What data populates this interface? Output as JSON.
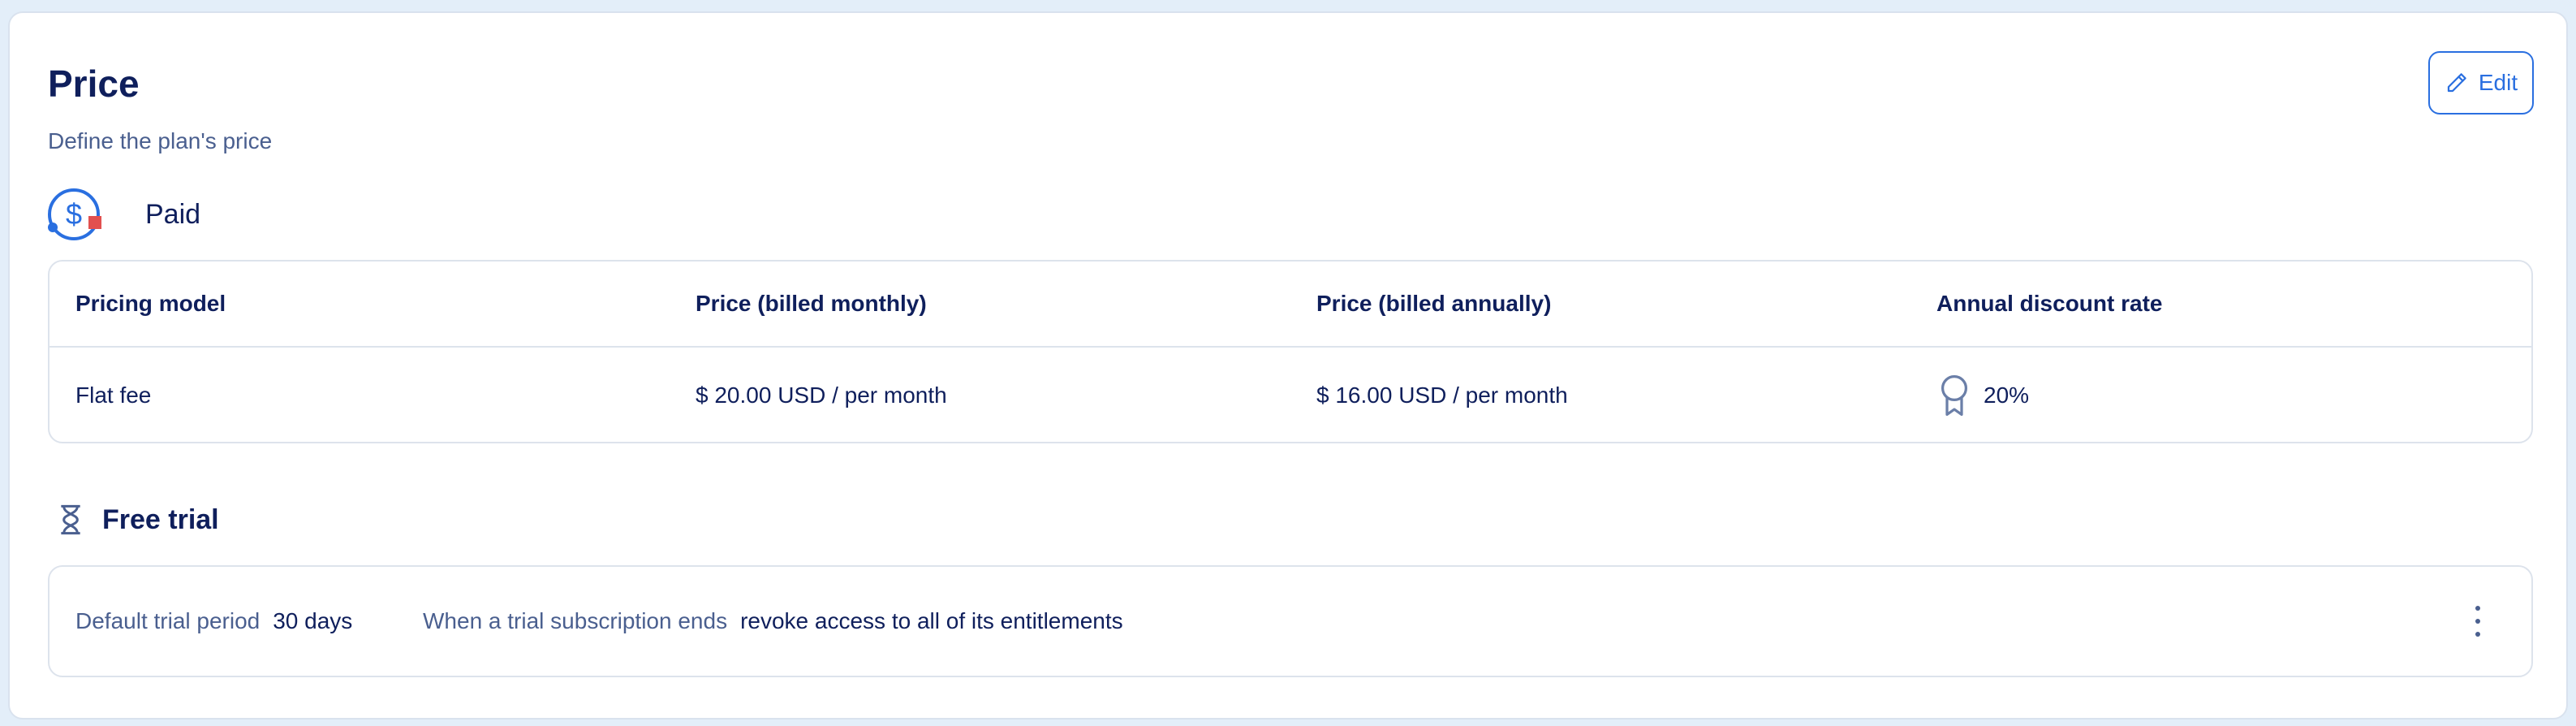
{
  "header": {
    "title": "Price",
    "subtitle": "Define the plan's price",
    "edit_label": "Edit"
  },
  "plan_type": {
    "label": "Paid",
    "icon": "dollar-circle-icon"
  },
  "price_table": {
    "columns": [
      "Pricing model",
      "Price (billed monthly)",
      "Price (billed annually)",
      "Annual discount rate"
    ],
    "row": {
      "pricing_model": "Flat fee",
      "monthly": "$ 20.00 USD / per month",
      "annually": "$ 16.00 USD / per month",
      "discount": "20%"
    }
  },
  "free_trial": {
    "label": "Free trial",
    "icon": "hourglass-icon",
    "default_period_key": "Default trial period",
    "default_period_value": "30 days",
    "ends_key": "When a trial subscription ends",
    "ends_value": "revoke access to all of its entitlements"
  },
  "colors": {
    "accent": "#2a6fe0",
    "text_primary": "#0f1f5c",
    "text_secondary": "#4a5f8f",
    "border": "#dde3ec",
    "badge_red": "#e2504f"
  }
}
